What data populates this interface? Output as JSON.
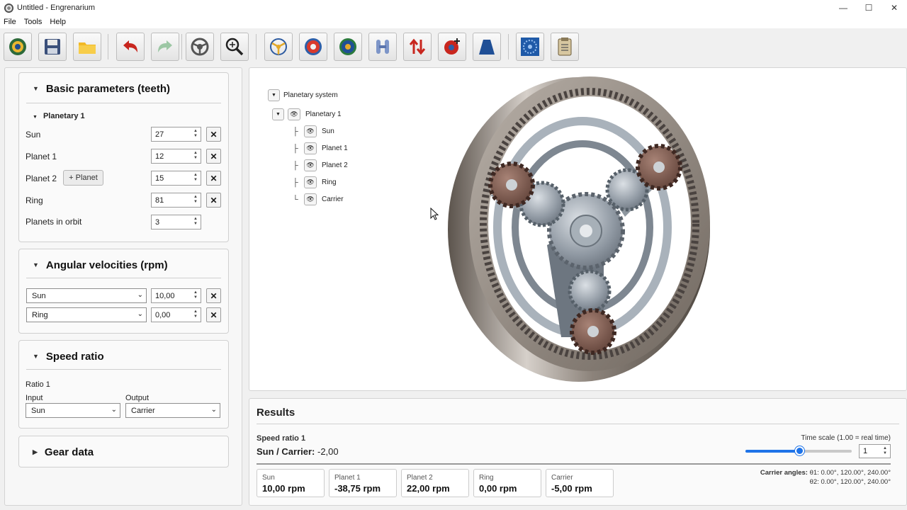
{
  "window": {
    "title": "Untitled - Engrenarium",
    "minimize": "—",
    "maximize": "☐",
    "close": "✕"
  },
  "menu": [
    "File",
    "Tools",
    "Help"
  ],
  "toolbar": [
    {
      "name": "home-button",
      "icon": "planetary-gear-icon"
    },
    {
      "name": "save-button",
      "icon": "save-icon"
    },
    {
      "name": "open-button",
      "icon": "folder-icon"
    },
    {
      "name": "undo-button",
      "icon": "undo-icon"
    },
    {
      "name": "redo-button",
      "icon": "redo-icon"
    },
    {
      "name": "reset-view-button",
      "icon": "steering-wheel-icon"
    },
    {
      "name": "zoom-button",
      "icon": "zoom-icon"
    },
    {
      "name": "carrier-view-button",
      "icon": "carrier-icon"
    },
    {
      "name": "sun-view-button",
      "icon": "sun-gear-icon"
    },
    {
      "name": "planet-view-button",
      "icon": "planet-gear-icon"
    },
    {
      "name": "mesh-button",
      "icon": "mesh-icon"
    },
    {
      "name": "direction-button",
      "icon": "arrows-updown-icon"
    },
    {
      "name": "add-gear-button",
      "icon": "add-gear-icon"
    },
    {
      "name": "tooth-profile-button",
      "icon": "tooth-profile-icon"
    },
    {
      "name": "gear-settings-button",
      "icon": "blue-gear-icon"
    },
    {
      "name": "report-button",
      "icon": "clipboard-icon"
    }
  ],
  "basic": {
    "title": "Basic parameters (teeth)",
    "group": "Planetary 1",
    "sun_label": "Sun",
    "sun_value": "27",
    "planet1_label": "Planet 1",
    "planet1_value": "12",
    "planet2_label": "Planet 2",
    "planet2_value": "15",
    "add_planet": "+ Planet",
    "ring_label": "Ring",
    "ring_value": "81",
    "orbit_label": "Planets in orbit",
    "orbit_value": "3",
    "remove": "✕"
  },
  "velocity": {
    "title": "Angular velocities (rpm)",
    "row1_member": "Sun",
    "row1_value": "10,00",
    "row2_member": "Ring",
    "row2_value": "0,00"
  },
  "speed_ratio": {
    "title": "Speed ratio",
    "ratio_label": "Ratio 1",
    "input_label": "Input",
    "input_value": "Sun",
    "output_label": "Output",
    "output_value": "Carrier"
  },
  "gear_data": {
    "title": "Gear data"
  },
  "tree": {
    "root": "Planetary system",
    "group": "Planetary 1",
    "items": [
      "Sun",
      "Planet 1",
      "Planet 2",
      "Ring",
      "Carrier"
    ]
  },
  "results": {
    "title": "Results",
    "ratio_title": "Speed ratio 1",
    "ratio_key": "Sun / Carrier:",
    "ratio_value": "-2,00",
    "time_scale_label": "Time scale (1.00 = real time)",
    "time_scale_value": "1",
    "carrier_angles_label": "Carrier angles:",
    "theta1": "θ1: 0.00°, 120.00°, 240.00°",
    "theta2": "θ2: 0.00°, 120.00°, 240.00°",
    "speeds": [
      {
        "name": "Sun",
        "value": "10,00 rpm"
      },
      {
        "name": "Planet 1",
        "value": "-38,75 rpm"
      },
      {
        "name": "Planet 2",
        "value": "22,00 rpm"
      },
      {
        "name": "Ring",
        "value": "0,00 rpm"
      },
      {
        "name": "Carrier",
        "value": "-5,00 rpm"
      }
    ]
  },
  "colors": {
    "accent": "#1e73e8",
    "planet_gear": "#6e4b40",
    "steel": "#9aa4ae",
    "ring": "#8a8078"
  }
}
